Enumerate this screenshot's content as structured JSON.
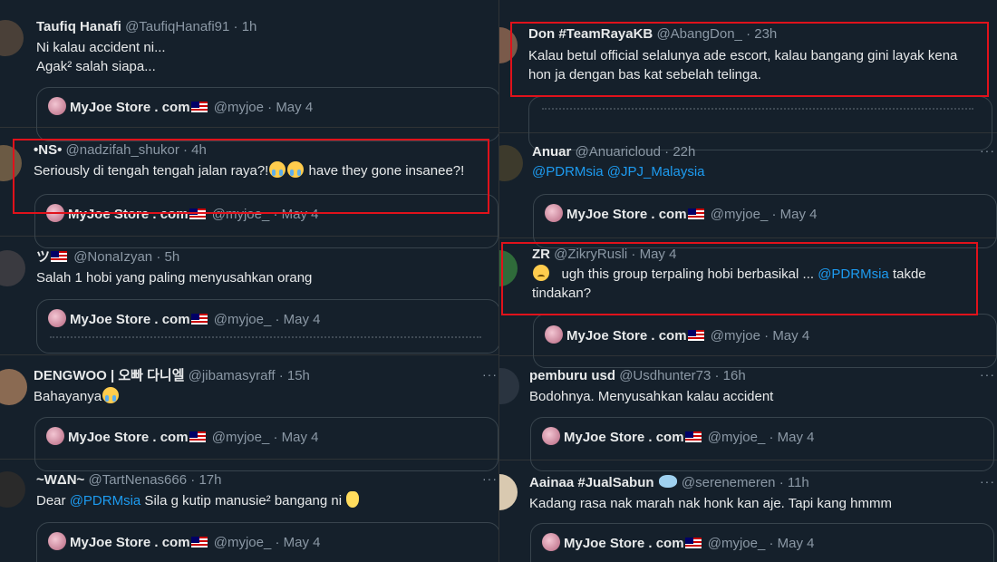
{
  "quote_card": {
    "name": "MyJoe Store . com",
    "handle": "@myjoe_",
    "date": "May 4",
    "first_handle": "@myjoe"
  },
  "more_label": "···",
  "dot": "·",
  "left_tweets": [
    {
      "name": "Taufiq Hanafi",
      "handle": "@TaufiqHanafi91",
      "time": "1h",
      "line1": "Ni kalau accident ni...",
      "line2": "Agak² salah siapa..."
    },
    {
      "name": "•NS•",
      "handle": "@nadzifah_shukor",
      "time": "4h",
      "text": "Seriously di tengah tengah jalan raya?!",
      "text_after": " have they gone insanee?!"
    },
    {
      "name": "ツ",
      "handle": "@NonaIzyan",
      "time": "5h",
      "text": "Salah 1 hobi yang paling menyusahkan orang"
    },
    {
      "name": "DENGWOO | 오빠 다니엘",
      "handle": "@jibamasyraff",
      "time": "15h",
      "text": "Bahayanya"
    },
    {
      "name": "~WΔN~",
      "handle": "@TartNenas666",
      "time": "17h",
      "text_before": "Dear ",
      "mention": "@PDRMsia",
      "text_after": " Sila g kutip manusie² bangang ni"
    }
  ],
  "right_tweets": [
    {
      "name": "Don #TeamRayaKB",
      "handle": "@AbangDon_",
      "time": "23h",
      "line1": "Kalau betul official selalunya ade escort, kalau bangang gini layak kena",
      "line2": "hon ja dengan bas kat sebelah telinga."
    },
    {
      "name": "Anuar",
      "handle": "@Anuaricloud",
      "time": "22h",
      "mention1": "@PDRMsia",
      "mention2": "@JPJ_Malaysia"
    },
    {
      "name": "ZR",
      "handle": "@ZikryRusli",
      "time": "May 4",
      "text_before": "ugh this group terpaling hobi berbasikal  ... ",
      "mention": "@PDRMsia",
      "text_after": " takde",
      "line2": "tindakan?"
    },
    {
      "name": "pemburu usd",
      "handle": "@Usdhunter73",
      "time": "16h",
      "text": "Bodohnya. Menyusahkan kalau accident"
    },
    {
      "name": "Aainaa #JualSabun",
      "handle": "@serenemeren",
      "time": "11h",
      "text": "Kadang rasa nak marah nak honk kan aje. Tapi kang hmmm"
    }
  ]
}
